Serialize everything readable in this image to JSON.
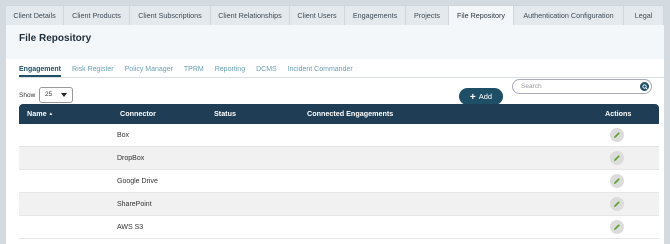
{
  "top_tabs": [
    {
      "label": "Client Details",
      "active": false
    },
    {
      "label": "Client Products",
      "active": false
    },
    {
      "label": "Client Subscriptions",
      "active": false
    },
    {
      "label": "Client Relationships",
      "active": false
    },
    {
      "label": "Client Users",
      "active": false
    },
    {
      "label": "Engagements",
      "active": false
    },
    {
      "label": "Projects",
      "active": false
    },
    {
      "label": "File Repository",
      "active": true
    },
    {
      "label": "Authentication Configuration",
      "active": false
    },
    {
      "label": "Legal",
      "active": false
    }
  ],
  "page_title": "File Repository",
  "sub_tabs": [
    {
      "label": "Engagement",
      "active": true
    },
    {
      "label": "Risk Register",
      "active": false
    },
    {
      "label": "Policy Manager",
      "active": false
    },
    {
      "label": "TPRM",
      "active": false
    },
    {
      "label": "Reporting",
      "active": false
    },
    {
      "label": "DCMS",
      "active": false
    },
    {
      "label": "Incident Commander",
      "active": false
    }
  ],
  "toolbar": {
    "show_label": "Show",
    "page_size": "25",
    "add_label": "Add",
    "search_placeholder": "Search"
  },
  "table": {
    "columns": [
      "Name",
      "Connector",
      "Status",
      "Connected Engagements",
      "Actions"
    ],
    "sort_indicator": "▲",
    "rows": [
      {
        "name": "",
        "connector": "Box",
        "status": "",
        "connected": ""
      },
      {
        "name": "",
        "connector": "DropBox",
        "status": "",
        "connected": ""
      },
      {
        "name": "",
        "connector": "Google Drive",
        "status": "",
        "connected": ""
      },
      {
        "name": "",
        "connector": "SharePoint",
        "status": "",
        "connected": ""
      },
      {
        "name": "",
        "connector": "AWS S3",
        "status": "",
        "connected": ""
      }
    ]
  },
  "colors": {
    "primary": "#1f4f66",
    "header": "#1f3e56",
    "edit_icon": "#5da02e"
  },
  "icons": {
    "add": "plus-icon",
    "search": "search-icon",
    "edit": "pencil-icon",
    "dropdown": "caret-down-icon"
  }
}
